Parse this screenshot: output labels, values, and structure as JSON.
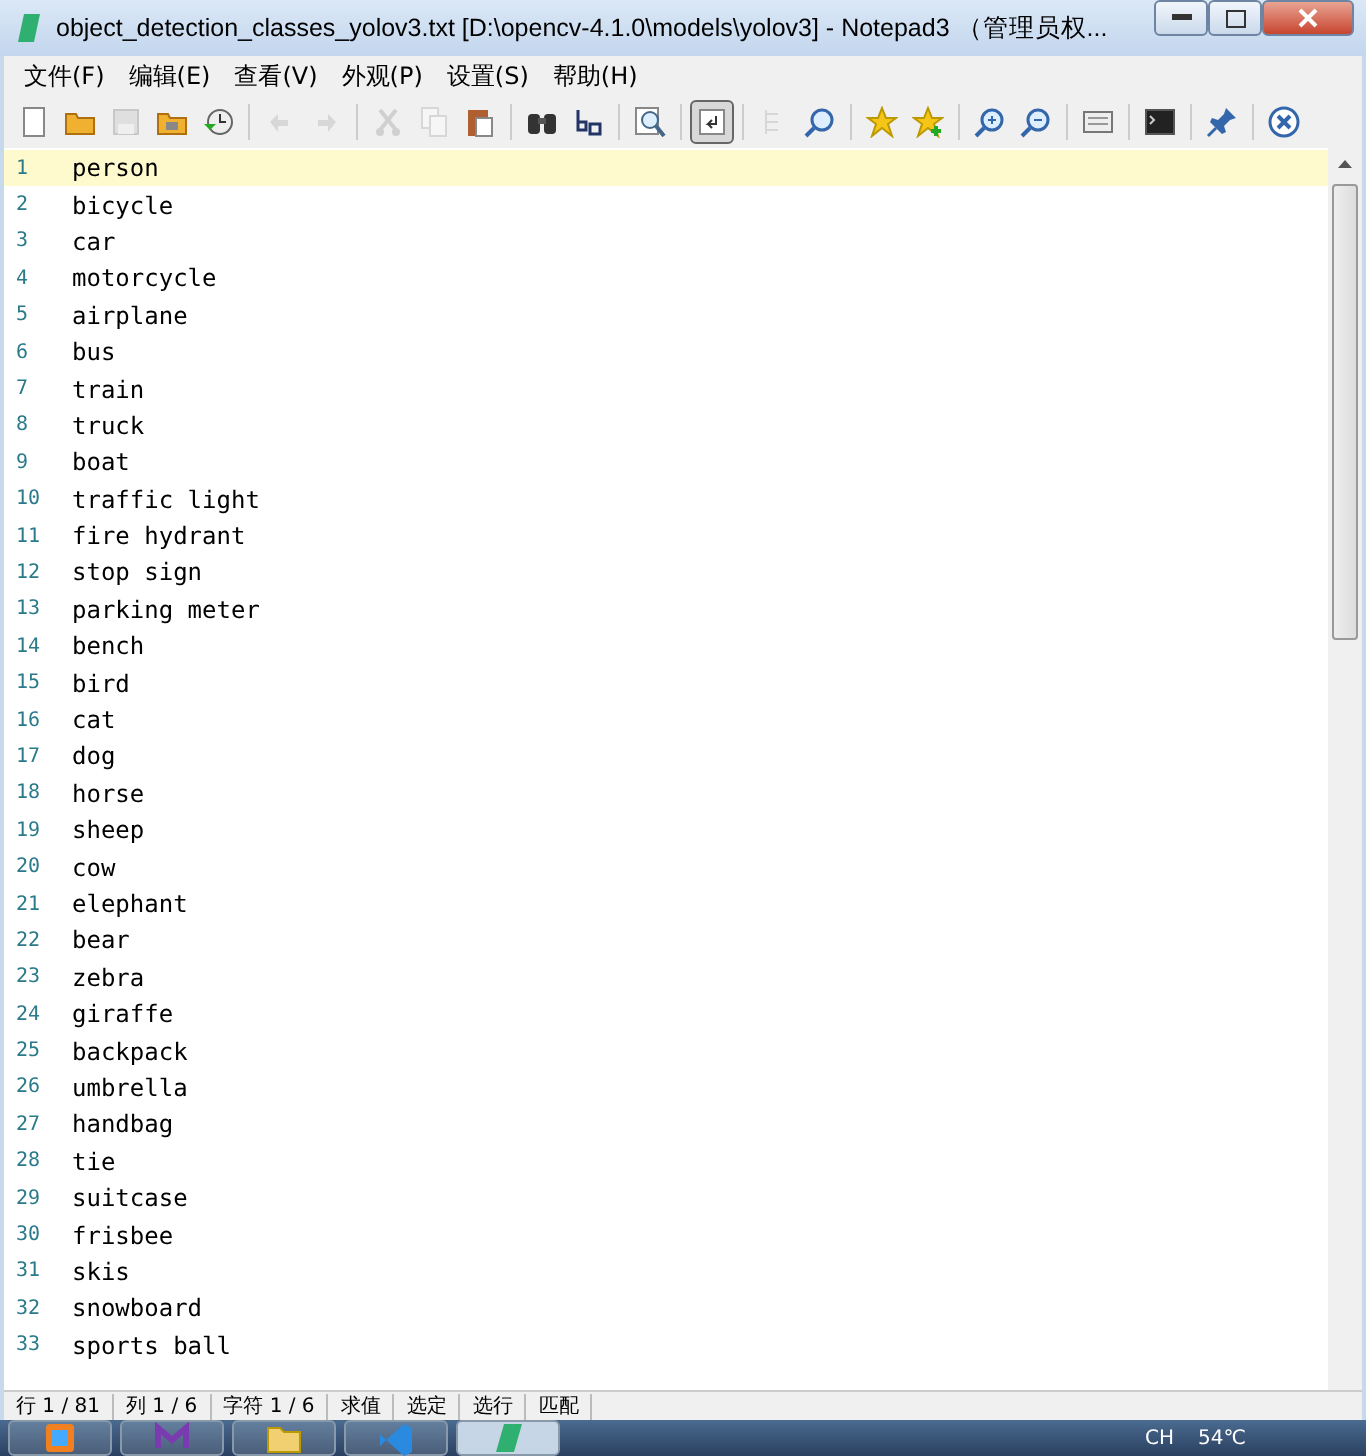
{
  "window": {
    "title": "object_detection_classes_yolov3.txt [D:\\opencv-4.1.0\\models\\yolov3] - Notepad3 （管理员权..."
  },
  "menu": [
    "文件(F)",
    "编辑(E)",
    "查看(V)",
    "外观(P)",
    "设置(S)",
    "帮助(H)"
  ],
  "toolbar": [
    {
      "kind": "new",
      "disabled": false,
      "selected": false
    },
    {
      "kind": "open",
      "disabled": false,
      "selected": false
    },
    {
      "kind": "save",
      "disabled": true,
      "selected": false
    },
    {
      "kind": "saveas",
      "disabled": false,
      "selected": false
    },
    {
      "kind": "recent",
      "disabled": false,
      "selected": false
    },
    {
      "kind": "sep"
    },
    {
      "kind": "undo",
      "disabled": true,
      "selected": false
    },
    {
      "kind": "redo",
      "disabled": true,
      "selected": false
    },
    {
      "kind": "sep"
    },
    {
      "kind": "cut",
      "disabled": true,
      "selected": false
    },
    {
      "kind": "copy",
      "disabled": true,
      "selected": false
    },
    {
      "kind": "paste",
      "disabled": false,
      "selected": false
    },
    {
      "kind": "sep"
    },
    {
      "kind": "find",
      "disabled": false,
      "selected": false
    },
    {
      "kind": "replace",
      "disabled": false,
      "selected": false
    },
    {
      "kind": "sep"
    },
    {
      "kind": "magnifier",
      "disabled": false,
      "selected": false
    },
    {
      "kind": "sep"
    },
    {
      "kind": "wrap",
      "disabled": false,
      "selected": true
    },
    {
      "kind": "sep"
    },
    {
      "kind": "outline",
      "disabled": true,
      "selected": false
    },
    {
      "kind": "zoomfind",
      "disabled": false,
      "selected": false
    },
    {
      "kind": "sep"
    },
    {
      "kind": "star",
      "disabled": false,
      "selected": false
    },
    {
      "kind": "staradd",
      "disabled": false,
      "selected": false
    },
    {
      "kind": "sep"
    },
    {
      "kind": "zoomin",
      "disabled": false,
      "selected": false
    },
    {
      "kind": "zoomout",
      "disabled": false,
      "selected": false
    },
    {
      "kind": "sep"
    },
    {
      "kind": "dialog",
      "disabled": false,
      "selected": false
    },
    {
      "kind": "sep"
    },
    {
      "kind": "console",
      "disabled": false,
      "selected": false
    },
    {
      "kind": "sep"
    },
    {
      "kind": "pin",
      "disabled": false,
      "selected": false
    },
    {
      "kind": "sep"
    },
    {
      "kind": "closefile",
      "disabled": false,
      "selected": false
    }
  ],
  "editor": {
    "lines": [
      {
        "number": "1",
        "text": "person",
        "selected": true
      },
      {
        "number": "2",
        "text": "bicycle",
        "selected": false
      },
      {
        "number": "3",
        "text": "car",
        "selected": false
      },
      {
        "number": "4",
        "text": "motorcycle",
        "selected": false
      },
      {
        "number": "5",
        "text": "airplane",
        "selected": false
      },
      {
        "number": "6",
        "text": "bus",
        "selected": false
      },
      {
        "number": "7",
        "text": "train",
        "selected": false
      },
      {
        "number": "8",
        "text": "truck",
        "selected": false
      },
      {
        "number": "9",
        "text": "boat",
        "selected": false
      },
      {
        "number": "10",
        "text": "traffic light",
        "selected": false
      },
      {
        "number": "11",
        "text": "fire hydrant",
        "selected": false
      },
      {
        "number": "12",
        "text": "stop sign",
        "selected": false
      },
      {
        "number": "13",
        "text": "parking meter",
        "selected": false
      },
      {
        "number": "14",
        "text": "bench",
        "selected": false
      },
      {
        "number": "15",
        "text": "bird",
        "selected": false
      },
      {
        "number": "16",
        "text": "cat",
        "selected": false
      },
      {
        "number": "17",
        "text": "dog",
        "selected": false
      },
      {
        "number": "18",
        "text": "horse",
        "selected": false
      },
      {
        "number": "19",
        "text": "sheep",
        "selected": false
      },
      {
        "number": "20",
        "text": "cow",
        "selected": false
      },
      {
        "number": "21",
        "text": "elephant",
        "selected": false
      },
      {
        "number": "22",
        "text": "bear",
        "selected": false
      },
      {
        "number": "23",
        "text": "zebra",
        "selected": false
      },
      {
        "number": "24",
        "text": "giraffe",
        "selected": false
      },
      {
        "number": "25",
        "text": "backpack",
        "selected": false
      },
      {
        "number": "26",
        "text": "umbrella",
        "selected": false
      },
      {
        "number": "27",
        "text": "handbag",
        "selected": false
      },
      {
        "number": "28",
        "text": "tie",
        "selected": false
      },
      {
        "number": "29",
        "text": "suitcase",
        "selected": false
      },
      {
        "number": "30",
        "text": "frisbee",
        "selected": false
      },
      {
        "number": "31",
        "text": "skis",
        "selected": false
      },
      {
        "number": "32",
        "text": "snowboard",
        "selected": false
      },
      {
        "number": "33",
        "text": "sports ball",
        "selected": false
      }
    ]
  },
  "status_bar": [
    "行 1 / 81",
    "列 1 / 6",
    "字符 1 / 6",
    "求值",
    "选定",
    "选行",
    "匹配"
  ],
  "taskbar": {
    "apps": [
      {
        "kind": "orange",
        "selected": false
      },
      {
        "kind": "purple",
        "selected": false
      },
      {
        "kind": "folder",
        "selected": false
      },
      {
        "kind": "blue",
        "selected": false
      },
      {
        "kind": "green",
        "selected": true
      }
    ],
    "language": "CH",
    "temperature": "54℃"
  }
}
